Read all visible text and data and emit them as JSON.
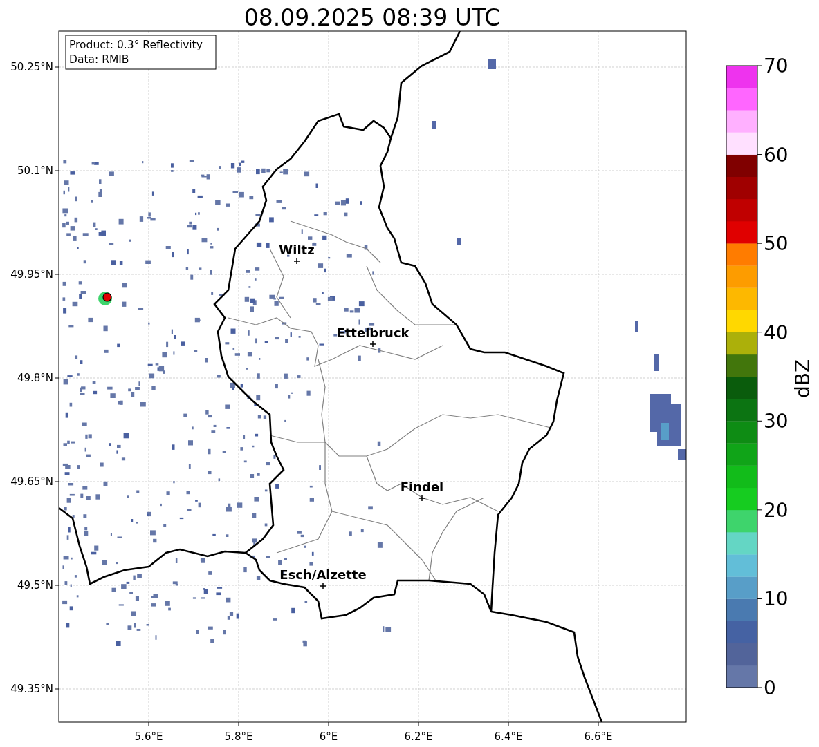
{
  "title": "08.09.2025 08:39 UTC",
  "legend": [
    "Product: 0.3° Reflectivity",
    "Data: RMIB"
  ],
  "map": {
    "x_ticks": [
      "5.6°E",
      "5.8°E",
      "6°E",
      "6.2°E",
      "6.4°E",
      "6.6°E"
    ],
    "y_ticks": [
      "50.25°N",
      "50.1°N",
      "49.95°N",
      "49.8°N",
      "49.65°N",
      "49.5°N",
      "49.35°N"
    ],
    "cities": [
      {
        "name": "Wiltz"
      },
      {
        "name": "Ettelbruck"
      },
      {
        "name": "Findel"
      },
      {
        "name": "Esch/Alzette"
      }
    ]
  },
  "colorbar": {
    "label": "dBZ",
    "ticks": [
      "70",
      "60",
      "50",
      "40",
      "30",
      "20",
      "10",
      "0"
    ],
    "bins": [
      {
        "color": "#6577a8"
      },
      {
        "color": "#52649a"
      },
      {
        "color": "#4562a3"
      },
      {
        "color": "#4a7ab0"
      },
      {
        "color": "#589ec8"
      },
      {
        "color": "#62bed8"
      },
      {
        "color": "#64d6c4"
      },
      {
        "color": "#3ed46c"
      },
      {
        "color": "#16cc20"
      },
      {
        "color": "#12bc1a"
      },
      {
        "color": "#10a418"
      },
      {
        "color": "#0e8c14"
      },
      {
        "color": "#0c7412"
      },
      {
        "color": "#0a5c0c"
      },
      {
        "color": "#42760c"
      },
      {
        "color": "#acb00a"
      },
      {
        "color": "#ffd800"
      },
      {
        "color": "#fdb800"
      },
      {
        "color": "#fd9c00"
      },
      {
        "color": "#ff7c00"
      },
      {
        "color": "#e00000"
      },
      {
        "color": "#c00000"
      },
      {
        "color": "#a00000"
      },
      {
        "color": "#800000"
      },
      {
        "color": "#ffe0ff"
      },
      {
        "color": "#ffb0ff"
      },
      {
        "color": "#ff66ff"
      },
      {
        "color": "#ee33ee"
      }
    ]
  }
}
